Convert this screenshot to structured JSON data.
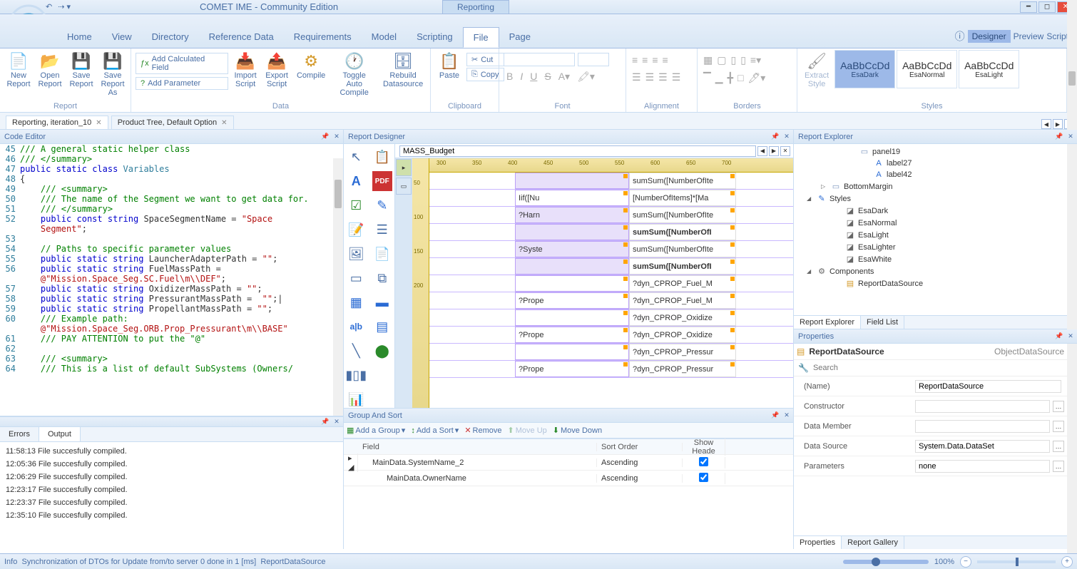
{
  "app": {
    "title": "COMET IME - Community Edition",
    "context_tab": "Reporting"
  },
  "menu": {
    "items": [
      "Home",
      "View",
      "Directory",
      "Reference Data",
      "Requirements",
      "Model",
      "Scripting",
      "File",
      "Page"
    ],
    "active": "File",
    "right": {
      "designer": "Designer",
      "preview": "Preview",
      "scripts": "Scripts"
    }
  },
  "ribbon": {
    "report": {
      "label": "Report",
      "new": "New\nReport",
      "open": "Open\nReport",
      "save": "Save\nReport",
      "saveas": "Save\nReport As"
    },
    "data": {
      "label": "Data",
      "addcalc": "Add Calculated Field",
      "addparam": "Add Parameter",
      "import": "Import\nScript",
      "export": "Export\nScript",
      "compile": "Compile",
      "autocompile": "Toggle Auto\nCompile",
      "rebuild": "Rebuild\nDatasource"
    },
    "clipboard": {
      "label": "Clipboard",
      "paste": "Paste",
      "cut": "Cut",
      "copy": "Copy"
    },
    "font": {
      "label": "Font"
    },
    "alignment": {
      "label": "Alignment"
    },
    "borders": {
      "label": "Borders"
    },
    "styles": {
      "label": "Styles",
      "extract": "Extract\nStyle",
      "items": [
        {
          "sample": "AaBbCcDd",
          "name": "EsaDark"
        },
        {
          "sample": "AaBbCcDd",
          "name": "EsaNormal"
        },
        {
          "sample": "AaBbCcDd",
          "name": "EsaLight"
        }
      ]
    }
  },
  "doctabs": [
    {
      "label": "Reporting, iteration_10",
      "active": true
    },
    {
      "label": "Product Tree, Default Option",
      "active": false
    }
  ],
  "codeeditor": {
    "title": "Code Editor",
    "lines": [
      {
        "n": 45,
        "html": "<span class='cmt'>/// A general static helper class</span>"
      },
      {
        "n": 46,
        "html": "<span class='cmt'>/// &lt;/summary&gt;</span>"
      },
      {
        "n": 47,
        "html": "<span class='kw'>public</span> <span class='kw'>static</span> <span class='kw'>class</span> <span class='ty'>Variables</span>"
      },
      {
        "n": 48,
        "html": "{"
      },
      {
        "n": 49,
        "html": "    <span class='cmt'>/// &lt;summary&gt;</span>"
      },
      {
        "n": 50,
        "html": "    <span class='cmt'>/// The name of the Segment we want to get data for.</span>"
      },
      {
        "n": 51,
        "html": "    <span class='cmt'>/// &lt;/summary&gt;</span>"
      },
      {
        "n": 52,
        "html": "    <span class='kw'>public</span> <span class='kw'>const</span> <span class='kw'>string</span> SpaceSegmentName = <span class='str'>\"Space</span>"
      },
      {
        "n": "",
        "html": "    <span class='str'>Segment\"</span>;"
      },
      {
        "n": 53,
        "html": ""
      },
      {
        "n": 54,
        "html": "    <span class='cmt'>// Paths to specific parameter values</span>"
      },
      {
        "n": 55,
        "html": "    <span class='kw'>public</span> <span class='kw'>static</span> <span class='kw'>string</span> LauncherAdapterPath = <span class='str'>\"\"</span>;"
      },
      {
        "n": 56,
        "html": "    <span class='kw'>public</span> <span class='kw'>static</span> <span class='kw'>string</span> FuelMassPath ="
      },
      {
        "n": "",
        "html": "    <span class='str'>@\"Mission.Space_Seg.SC.Fuel\\m\\\\DEF\"</span>;"
      },
      {
        "n": 57,
        "html": "    <span class='kw'>public</span> <span class='kw'>static</span> <span class='kw'>string</span> OxidizerMassPath = <span class='str'>\"\"</span>;"
      },
      {
        "n": 58,
        "html": "    <span class='kw'>public</span> <span class='kw'>static</span> <span class='kw'>string</span> PressurantMassPath =  <span class='str'>\"\"</span>;|"
      },
      {
        "n": 59,
        "html": "    <span class='kw'>public</span> <span class='kw'>static</span> <span class='kw'>string</span> PropellantMassPath = <span class='str'>\"\"</span>;"
      },
      {
        "n": 60,
        "html": "    <span class='cmt'>/// Example path:</span>"
      },
      {
        "n": "",
        "html": "    <span class='str'>@\"Mission.Space_Seg.ORB.Prop_Pressurant\\m\\\\BASE\"</span>"
      },
      {
        "n": 61,
        "html": "    <span class='cmt'>/// PAY ATTENTION to put the \"@\"</span>"
      },
      {
        "n": 62,
        "html": ""
      },
      {
        "n": 63,
        "html": "    <span class='cmt'>/// &lt;summary&gt;</span>"
      },
      {
        "n": 64,
        "html": "    <span class='cmt'>/// This is a list of default SubSystems (Owners/</span>"
      }
    ]
  },
  "errorsoutput": {
    "tabs": {
      "errors": "Errors",
      "output": "Output",
      "active": "Output"
    },
    "lines": [
      "11:58:13 File succesfully compiled.",
      "12:05:36 File succesfully compiled.",
      "12:06:29 File succesfully compiled.",
      "12:23:17 File succesfully compiled.",
      "12:23:37 File succesfully compiled.",
      "12:35:10 File succesfully compiled."
    ]
  },
  "designer": {
    "title": "Report Designer",
    "tab_value": "MASS_Budget",
    "ruler_h": [
      300,
      350,
      400,
      450,
      500,
      550,
      600,
      650,
      700
    ],
    "ruler_v": [
      50,
      100,
      150,
      200
    ],
    "rows": [
      {
        "left": "",
        "right": "sumSum([NumberOfIte",
        "bold": false
      },
      {
        "left": "Iif([Nu",
        "right": "[NumberOfItems]*[Ma",
        "bg": "#fff"
      },
      {
        "left": "?Harn",
        "right": "sumSum([NumberOfIte",
        "bold": false
      },
      {
        "left": "",
        "right": "sumSum([NumberOfI",
        "bold": true
      },
      {
        "left": "?Syste",
        "right": "sumSum([NumberOfIte",
        "bold": false
      },
      {
        "left": "",
        "right": "sumSum([NumberOfI",
        "bold": true
      },
      {
        "left": "",
        "right": "?dyn_CPROP_Fuel_M",
        "bg": "#fff"
      },
      {
        "left": "?Prope",
        "right": "?dyn_CPROP_Fuel_M",
        "bg": "#fff"
      },
      {
        "left": "",
        "right": "?dyn_CPROP_Oxidize",
        "bg": "#fff"
      },
      {
        "left": "?Prope",
        "right": "?dyn_CPROP_Oxidize",
        "bg": "#fff"
      },
      {
        "left": "",
        "right": "?dyn_CPROP_Pressur",
        "bg": "#fff"
      },
      {
        "left": "?Prope",
        "right": "?dyn_CPROP_Pressur",
        "bg": "#fff"
      }
    ]
  },
  "groupsort": {
    "title": "Group And Sort",
    "buttons": {
      "addgroup": "Add a Group",
      "addsort": "Add a Sort",
      "remove": "Remove",
      "moveup": "Move Up",
      "movedown": "Move Down"
    },
    "headers": {
      "field": "Field",
      "order": "Sort Order",
      "show": "Show Heade"
    },
    "rows": [
      {
        "field": "MainData.SystemName_2",
        "order": "Ascending",
        "show": true
      },
      {
        "field": "MainData.OwnerName",
        "order": "Ascending",
        "show": true
      }
    ]
  },
  "explorer": {
    "title": "Report Explorer",
    "items": [
      {
        "indent": 70,
        "tri": "",
        "icon": "▭",
        "label": "panel19",
        "color": "#7a95be"
      },
      {
        "indent": 90,
        "tri": "",
        "icon": "A",
        "label": "label27",
        "color": "#2a6bd4"
      },
      {
        "indent": 90,
        "tri": "",
        "icon": "A",
        "label": "label42",
        "color": "#2a6bd4"
      },
      {
        "indent": 30,
        "tri": "▷",
        "icon": "▭",
        "label": "BottomMargin",
        "color": "#7a95be"
      },
      {
        "indent": 10,
        "tri": "◢",
        "icon": "✎",
        "label": "Styles",
        "color": "#2a6bd4"
      },
      {
        "indent": 50,
        "tri": "",
        "icon": "◪",
        "label": "EsaDark",
        "color": "#666"
      },
      {
        "indent": 50,
        "tri": "",
        "icon": "◪",
        "label": "EsaNormal",
        "color": "#666"
      },
      {
        "indent": 50,
        "tri": "",
        "icon": "◪",
        "label": "EsaLight",
        "color": "#666"
      },
      {
        "indent": 50,
        "tri": "",
        "icon": "◪",
        "label": "EsaLighter",
        "color": "#666"
      },
      {
        "indent": 50,
        "tri": "",
        "icon": "◪",
        "label": "EsaWhite",
        "color": "#666"
      },
      {
        "indent": 10,
        "tri": "◢",
        "icon": "⚙",
        "label": "Components",
        "color": "#666"
      },
      {
        "indent": 50,
        "tri": "",
        "icon": "▤",
        "label": "ReportDataSource",
        "color": "#d49a2a"
      }
    ],
    "tabs": {
      "explorer": "Report Explorer",
      "fieldlist": "Field List"
    }
  },
  "properties": {
    "title": "Properties",
    "object": "ReportDataSource",
    "type": "ObjectDataSource",
    "search_placeholder": "Search",
    "rows": [
      {
        "name": "(Name)",
        "value": "ReportDataSource",
        "dots": false
      },
      {
        "name": "Constructor",
        "value": "",
        "dots": true
      },
      {
        "name": "Data Member",
        "value": "",
        "dots": true
      },
      {
        "name": "Data Source",
        "value": "System.Data.DataSet",
        "dots": true
      },
      {
        "name": "Parameters",
        "value": "none",
        "dots": true
      }
    ],
    "tabs": {
      "properties": "Properties",
      "gallery": "Report Gallery"
    }
  },
  "statusbar": {
    "info_label": "Info",
    "message": "Synchronization of DTOs for Update from/to server 0 done in 1 [ms]",
    "source": "ReportDataSource",
    "zoom": "100%"
  }
}
